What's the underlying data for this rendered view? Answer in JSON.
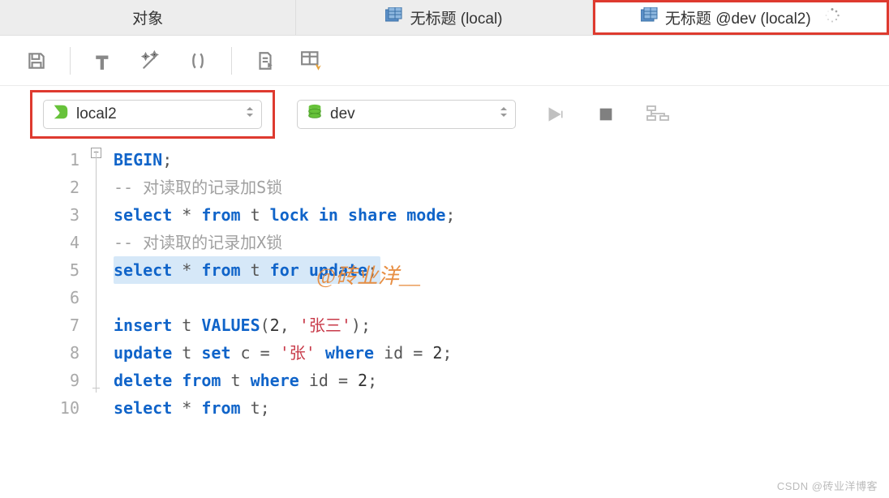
{
  "tabs": [
    {
      "label": "对象",
      "icon": null
    },
    {
      "label": "无标题 (local)",
      "icon": "table"
    },
    {
      "label": "无标题 @dev (local2)",
      "icon": "table",
      "active": true,
      "loading": true
    }
  ],
  "toolbar": {
    "save": "保存",
    "hammer": "构建",
    "magic": "美化",
    "paren": "括号",
    "doc": "导出",
    "run_table": "运行表"
  },
  "selectors": {
    "connection": {
      "value": "local2",
      "icon": "connection"
    },
    "database": {
      "value": "dev",
      "icon": "database"
    }
  },
  "actions": {
    "run": "运行",
    "stop": "停止",
    "explain": "解释"
  },
  "code": {
    "lines": [
      {
        "n": 1,
        "type": "stmt",
        "tokens": [
          [
            "kw",
            "BEGIN"
          ],
          [
            "op",
            ";"
          ]
        ]
      },
      {
        "n": 2,
        "type": "comment",
        "text": "-- 对读取的记录加S锁"
      },
      {
        "n": 3,
        "type": "stmt",
        "tokens": [
          [
            "kw",
            "select"
          ],
          [
            "op",
            " * "
          ],
          [
            "kw",
            "from"
          ],
          [
            "op",
            " t "
          ],
          [
            "kw",
            "lock in share mode"
          ],
          [
            "op",
            ";"
          ]
        ]
      },
      {
        "n": 4,
        "type": "comment",
        "text": "-- 对读取的记录加X锁"
      },
      {
        "n": 5,
        "type": "stmt",
        "highlight": true,
        "tokens": [
          [
            "kw",
            "select"
          ],
          [
            "op",
            " * "
          ],
          [
            "kw",
            "from"
          ],
          [
            "op",
            " t "
          ],
          [
            "kw",
            "for update"
          ],
          [
            "op",
            ";"
          ]
        ]
      },
      {
        "n": 6,
        "type": "blank"
      },
      {
        "n": 7,
        "type": "stmt",
        "tokens": [
          [
            "kw",
            "insert"
          ],
          [
            "op",
            " t "
          ],
          [
            "kw",
            "VALUES"
          ],
          [
            "op",
            "("
          ],
          [
            "num",
            "2"
          ],
          [
            "op",
            ", "
          ],
          [
            "str",
            "'张三'"
          ],
          [
            "op",
            ");"
          ]
        ]
      },
      {
        "n": 8,
        "type": "stmt",
        "tokens": [
          [
            "kw",
            "update"
          ],
          [
            "op",
            " t "
          ],
          [
            "kw",
            "set"
          ],
          [
            "op",
            " c = "
          ],
          [
            "str",
            "'张'"
          ],
          [
            "op",
            " "
          ],
          [
            "kw",
            "where"
          ],
          [
            "op",
            " id = "
          ],
          [
            "num",
            "2"
          ],
          [
            "op",
            ";"
          ]
        ]
      },
      {
        "n": 9,
        "type": "stmt",
        "tokens": [
          [
            "kw",
            "delete from"
          ],
          [
            "op",
            " t "
          ],
          [
            "kw",
            "where"
          ],
          [
            "op",
            " id = "
          ],
          [
            "num",
            "2"
          ],
          [
            "op",
            ";"
          ]
        ]
      },
      {
        "n": 10,
        "type": "stmt",
        "tokens": [
          [
            "kw",
            "select"
          ],
          [
            "op",
            " * "
          ],
          [
            "kw",
            "from"
          ],
          [
            "op",
            " t;"
          ]
        ]
      }
    ]
  },
  "watermark": "@砖业洋__",
  "footer_watermark": "CSDN @砖业洋博客"
}
